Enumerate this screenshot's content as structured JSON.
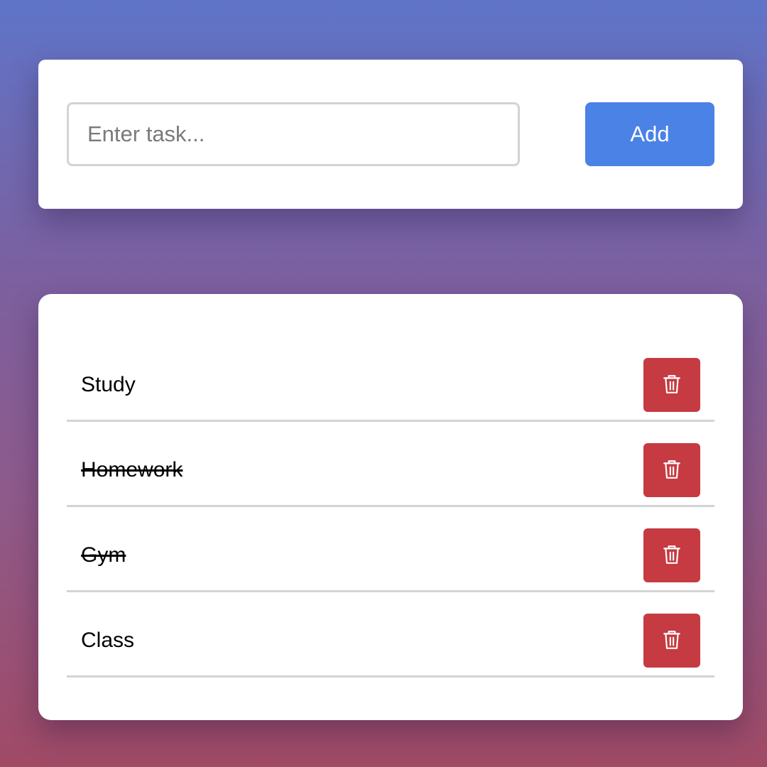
{
  "colors": {
    "accent": "#4a82e6",
    "danger": "#c63a42",
    "card": "#ffffff"
  },
  "input_section": {
    "value": "",
    "placeholder": "Enter task...",
    "add_label": "Add"
  },
  "tasks": [
    {
      "label": "Study",
      "completed": false,
      "delete_icon": "trash-icon"
    },
    {
      "label": "Homework",
      "completed": true,
      "delete_icon": "trash-icon"
    },
    {
      "label": "Gym",
      "completed": true,
      "delete_icon": "trash-icon"
    },
    {
      "label": "Class",
      "completed": false,
      "delete_icon": "trash-icon"
    }
  ]
}
